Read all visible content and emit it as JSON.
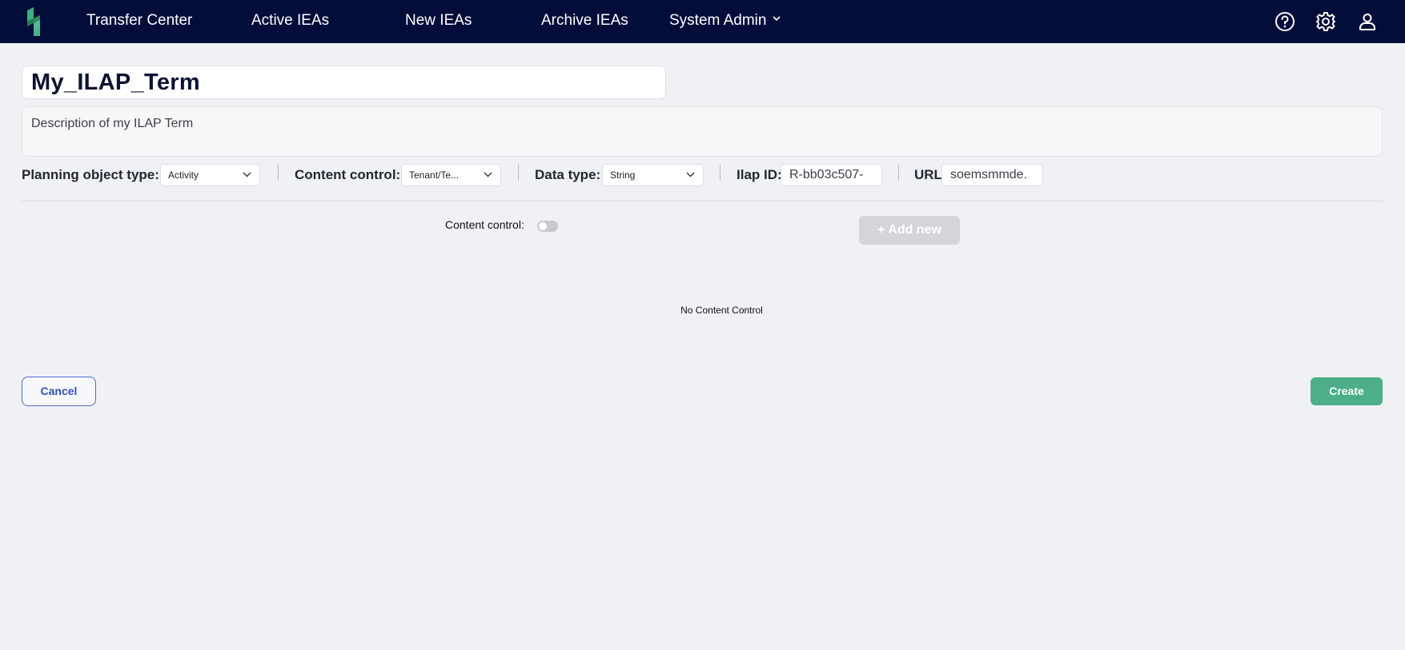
{
  "nav": {
    "items": [
      {
        "label": "Transfer Center"
      },
      {
        "label": "Active IEAs"
      },
      {
        "label": "New IEAs"
      },
      {
        "label": "Archive IEAs"
      },
      {
        "label": "System Admin"
      }
    ],
    "icons": [
      "logo-icon",
      "help-icon",
      "gear-icon",
      "user-icon"
    ]
  },
  "term": {
    "name": "My_ILAP_Term",
    "description": "Description of my ILAP Term"
  },
  "fields": {
    "planning_object_type": {
      "label": "Planning object type:",
      "value": "Activity"
    },
    "content_control": {
      "label": "Content control:",
      "value": "Tenant/Te..."
    },
    "data_type": {
      "label": "Data type:",
      "value": "String"
    },
    "ilap_id": {
      "label": "Ilap ID:",
      "value": "R-bb03c507-"
    },
    "url": {
      "label": "URL:",
      "value": "soemsmmde."
    }
  },
  "content_section": {
    "toggle_label": "Content control:",
    "toggle_on": false,
    "add_button": "+ Add new",
    "empty_message": "No Content Control"
  },
  "actions": {
    "cancel": "Cancel",
    "create": "Create"
  },
  "colors": {
    "nav_bg": "#020d3a",
    "accent_green": "#4caf8a",
    "accent_blue": "#3550b8",
    "page_bg": "#f0f1f5"
  }
}
